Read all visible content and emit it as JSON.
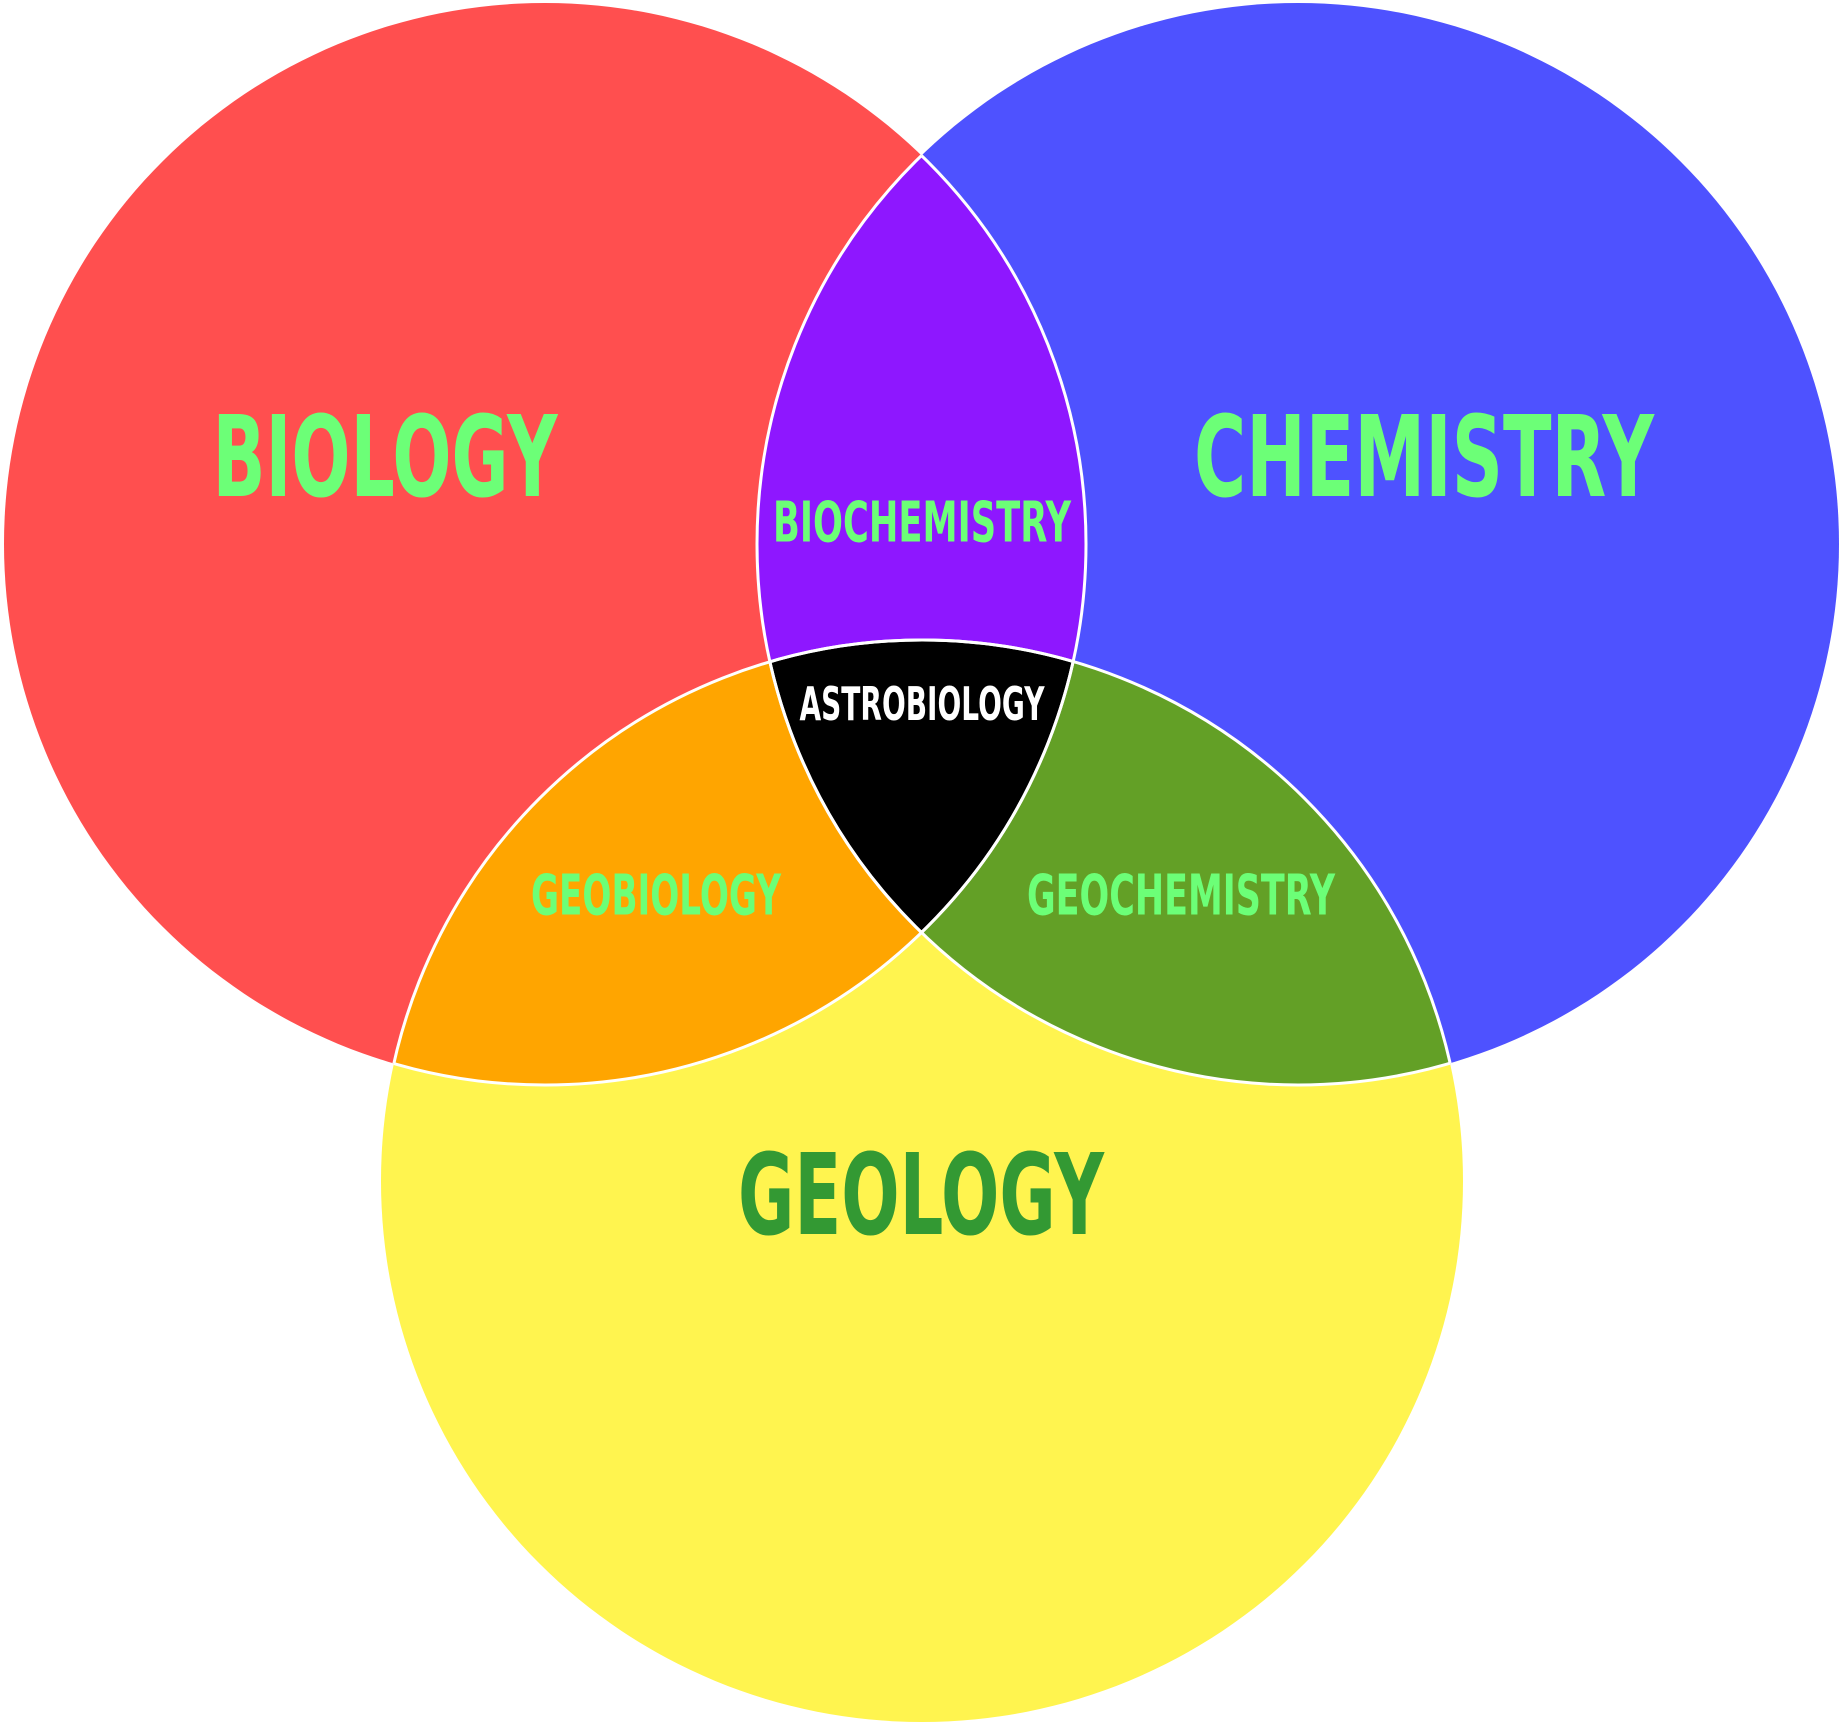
{
  "venn": {
    "sets": {
      "biology": {
        "label": "BIOLOGY",
        "fill": "#FF4F4F",
        "label_color": "#6CFF77"
      },
      "chemistry": {
        "label": "CHEMISTRY",
        "fill": "#4E52FF",
        "label_color": "#6CFF77"
      },
      "geology": {
        "label": "GEOLOGY",
        "fill": "#FFF44F",
        "label_color": "#339933"
      }
    },
    "intersections": {
      "biochemistry": {
        "label": "BIOCHEMISTRY",
        "fill": "#8E17FF",
        "label_color": "#6CFF77"
      },
      "geobiology": {
        "label": "GEOBIOLOGY",
        "fill": "#FFA500",
        "label_color": "#6CFF77"
      },
      "geochemistry": {
        "label": "GEOCHEMISTRY",
        "fill": "#63A026",
        "label_color": "#6CFF77"
      },
      "astrobiology": {
        "label": "ASTROBIOLOGY",
        "fill": "#000000",
        "label_color": "#FFFFFF"
      }
    },
    "outline_color": "#FFFFFF"
  }
}
